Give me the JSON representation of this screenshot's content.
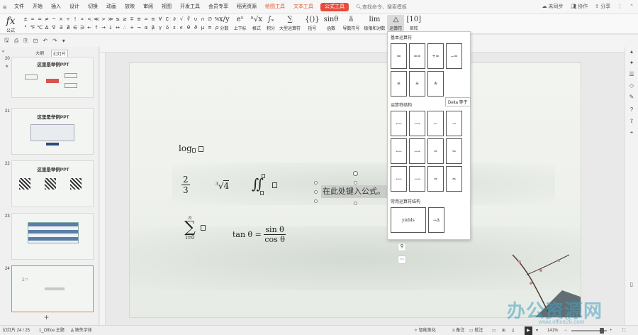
{
  "menubar": {
    "file": "文件",
    "items": [
      "开始",
      "插入",
      "设计",
      "切换",
      "动画",
      "放映",
      "审阅",
      "视图",
      "开发工具",
      "会员专享",
      "稻壳资源"
    ],
    "context_tabs": [
      "绘图工具",
      "文本工具"
    ],
    "active_tab": "公式工具",
    "search_placeholder": "查找命令、搜索模板",
    "unsynced": "未同步",
    "collaborate": "协作",
    "share": "分享"
  },
  "ribbon": {
    "fx_label": "公式",
    "symbols_row1": [
      "±",
      "∞",
      "=",
      "≠",
      "~",
      "×",
      "÷",
      "!",
      "∝",
      "<",
      "≪",
      ">",
      "≫",
      "≤",
      "≥",
      "∓",
      "≅",
      "≈",
      "≡",
      "∀",
      "∁",
      "∂",
      "√",
      "∛",
      "∪",
      "∩",
      "∅",
      "%"
    ],
    "symbols_row2": [
      "°",
      "℉",
      "℃",
      "∆",
      "∇",
      "∃",
      "∄",
      "∈",
      "∋",
      "←",
      "↑",
      "→",
      "↓",
      "↔",
      "∴",
      "+",
      "¬",
      "α",
      "β",
      "γ",
      "δ",
      "ε",
      "ϵ",
      "θ",
      "ϑ",
      "μ",
      "π",
      "ρ"
    ],
    "tools": [
      {
        "icon": "x/y",
        "label": "分数"
      },
      {
        "icon": "eˣ",
        "label": "上下标"
      },
      {
        "icon": "ⁿ√x",
        "label": "根式"
      },
      {
        "icon": "∫ₓ",
        "label": "积分"
      },
      {
        "icon": "∑",
        "label": "大型运算符"
      },
      {
        "icon": "{()}",
        "label": "括号"
      },
      {
        "icon": "sinθ",
        "label": "函数"
      },
      {
        "icon": "ä",
        "label": "导数符号"
      },
      {
        "icon": "lim",
        "label": "极限和对数"
      },
      {
        "icon": "△",
        "label": "运算符"
      },
      {
        "icon": "[10]",
        "label": "矩阵"
      }
    ]
  },
  "left_panel": {
    "tab_outline": "大纲",
    "tab_slides": "幻灯片",
    "slides": [
      {
        "num": "20",
        "title": "这里是举例PPT"
      },
      {
        "num": "21",
        "title": "这里是举例PPT"
      },
      {
        "num": "22",
        "title": "这里是举例PPT"
      },
      {
        "num": "23",
        "title": ""
      },
      {
        "num": "24",
        "title": ""
      }
    ],
    "star": "★"
  },
  "slide": {
    "log": "log",
    "frac_num": "2",
    "frac_den": "3",
    "cuberoot_index": "3",
    "cuberoot_radicand": "4",
    "double_integral": "∬",
    "sum_top": "n",
    "sum_bottom": "i=0",
    "sigma": "∑",
    "tan_lhs": "tan θ =",
    "tan_num": "sin θ",
    "tan_den": "cos θ",
    "textbox_text": "在此处键入公式。"
  },
  "dropdown": {
    "section_basic": "基本运算符",
    "basic_cells": [
      "≔",
      "==",
      "+=",
      "−=",
      "≝",
      "≞",
      "≜"
    ],
    "section_structures": "运算符结构",
    "structure_cells": [
      "⟵",
      "⟶",
      "←",
      "→",
      "⟵",
      "⟶",
      "⇐",
      "⇒",
      "⟵",
      "⟶",
      "⇔",
      "⇔"
    ],
    "section_common": "常用运算符结构",
    "common_cells": [
      "yields",
      "→∆"
    ],
    "tooltip": "Delta 等于"
  },
  "statusbar": {
    "slide_info": "幻灯片 24 / 25",
    "theme": "1_Office 主题",
    "missing_font": "缺失字体",
    "beautify": "智能美化",
    "notes": "备注",
    "comments": "批注",
    "zoom": "141%"
  },
  "watermark": {
    "text": "办公资源网",
    "url": "www.office26.com"
  }
}
